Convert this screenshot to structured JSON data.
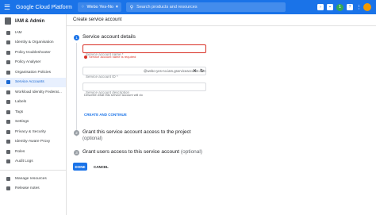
{
  "topbar": {
    "menu_icon": "hamburger-menu-icon",
    "title": "Google Cloud Platform",
    "project": "Webo Yes-No",
    "search_placeholder": "Search products and resources",
    "accent": "#1a73e8",
    "badge": "1"
  },
  "sidebar": {
    "title": "IAM & Admin",
    "items": [
      {
        "label": "IAM"
      },
      {
        "label": "Identity & Organisation"
      },
      {
        "label": "Policy troubleshooter"
      },
      {
        "label": "Policy Analyser"
      },
      {
        "label": "Organisation Policies"
      },
      {
        "label": "Service Accounts",
        "active": true
      },
      {
        "label": "Workload Identity Federat..."
      },
      {
        "label": "Labels"
      },
      {
        "label": "Tags"
      },
      {
        "label": "Settings"
      },
      {
        "label": "Privacy & Security"
      },
      {
        "label": "Identity-Aware Proxy"
      },
      {
        "label": "Roles"
      },
      {
        "label": "Audit Logs"
      }
    ],
    "footer": [
      {
        "label": "Manage resources"
      },
      {
        "label": "Release notes"
      }
    ]
  },
  "main": {
    "page_title": "Create service account",
    "step1": {
      "num": "1",
      "title": "Service account details",
      "name_placeholder": "Service account name *",
      "name_error": "Service account name is required",
      "id_placeholder": "Service account ID *",
      "id_suffix": "@webo-yes-no.iam.gserviceaccount.com",
      "desc_placeholder": "Service account description",
      "desc_helper": "Describe what this service account will do",
      "create_button": "CREATE AND CONTINUE"
    },
    "step2": {
      "num": "2",
      "title": "Grant this service account access to the project",
      "optional": "(optional)"
    },
    "step3": {
      "num": "3",
      "title": "Grant users access to this service account",
      "optional": "(optional)"
    },
    "done_button": "DONE",
    "cancel_button": "CANCEL"
  }
}
